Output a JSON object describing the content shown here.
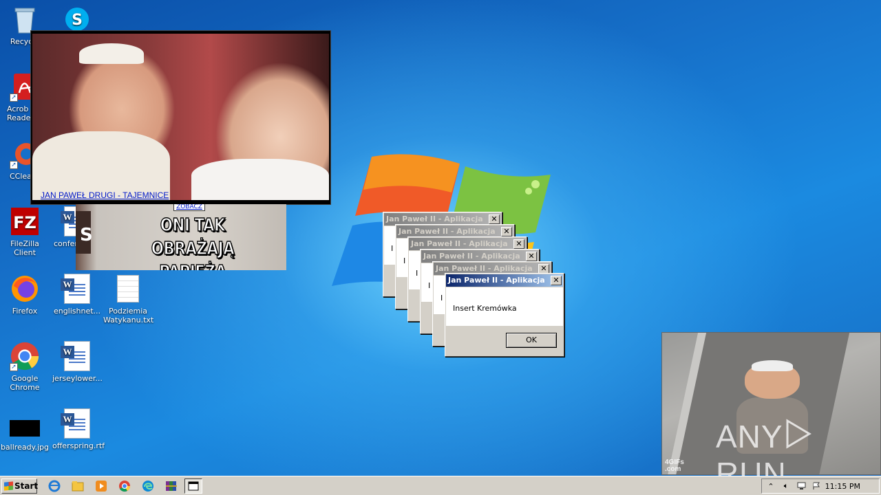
{
  "desktop": {
    "icons": [
      {
        "label": "Recycle",
        "icon": "recycle-bin-icon"
      },
      {
        "label": "Acrob Reader",
        "icon": "acrobat-icon"
      },
      {
        "label": "CClean",
        "icon": "ccleaner-icon"
      },
      {
        "label": "FileZilla Client",
        "icon": "filezilla-icon"
      },
      {
        "label": "confer",
        "icon": "word-doc-icon"
      },
      {
        "label": "Firefox",
        "icon": "firefox-icon"
      },
      {
        "label": "englishnet...",
        "icon": "word-doc-icon"
      },
      {
        "label": "Podziemia Watykanu.txt",
        "icon": "text-file-icon"
      },
      {
        "label": "Google Chrome",
        "icon": "chrome-icon"
      },
      {
        "label": "jerseylower...",
        "icon": "word-doc-icon"
      },
      {
        "label": "ballready.jpg",
        "icon": "image-file-icon"
      },
      {
        "label": "offerspring.rtf",
        "icon": "word-doc-icon"
      }
    ],
    "skype_icon": "skype-icon"
  },
  "popups": {
    "popup1_link": "JAN PAWEŁ DRUGI - TAJEMNICE",
    "popup2_cta": "ZOBACZ",
    "popup2_side_letter": "S",
    "popup2_meme": "ONI TAK OBRAŻAJĄ PAPIEŻA",
    "popup3_gif_mark": "4GIFs .com"
  },
  "watermark": {
    "left": "ANY",
    "right": "RUN"
  },
  "dialogs": {
    "title": "Jan Paweł II - Aplikacja",
    "message": "Insert Kremówka",
    "ok": "OK",
    "background_fragment": "I",
    "close": "✕"
  },
  "taskbar": {
    "start": "Start",
    "pinned": [
      "ie-icon",
      "explorer-icon",
      "media-player-icon",
      "chrome-icon",
      "edge-icon",
      "winrar-icon",
      "window-icon"
    ],
    "clock": "11:15 PM"
  },
  "colors": {
    "desktop": "#1670c9",
    "active_title": "#0a246a",
    "inactive_title": "#808080",
    "taskbar": "#d4d0c8"
  }
}
